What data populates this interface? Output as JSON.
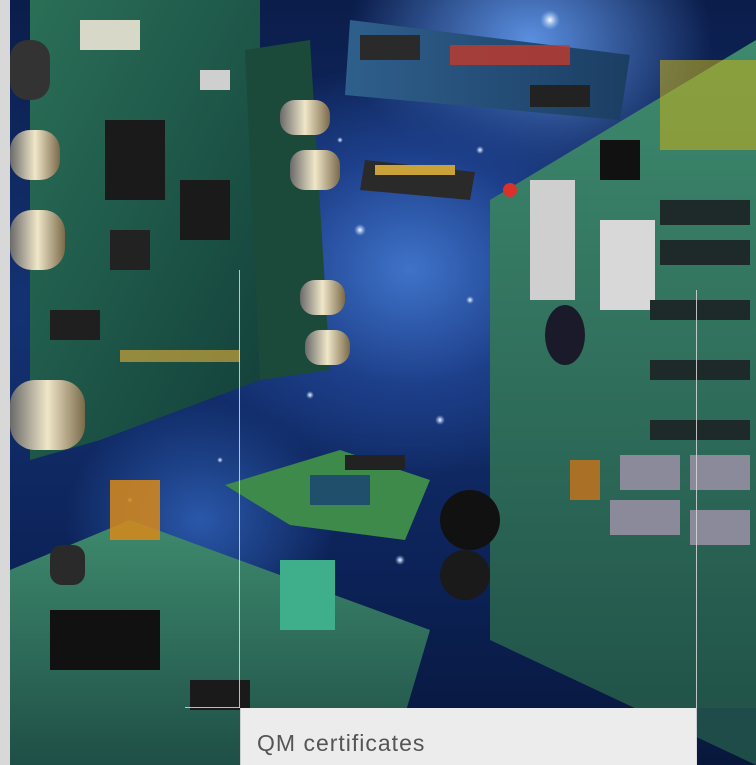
{
  "caption": {
    "title": "QM certificates"
  },
  "photo": {
    "subject": "circuit-boards-in-space",
    "colors": {
      "space_dark": "#07163a",
      "space_glow": "#3f73c9",
      "board_green": "#2f6b3a",
      "board_blue": "#1f4f8a",
      "gold": "#c9a23a",
      "panel": "#ececec",
      "caption_text": "#555555"
    }
  }
}
